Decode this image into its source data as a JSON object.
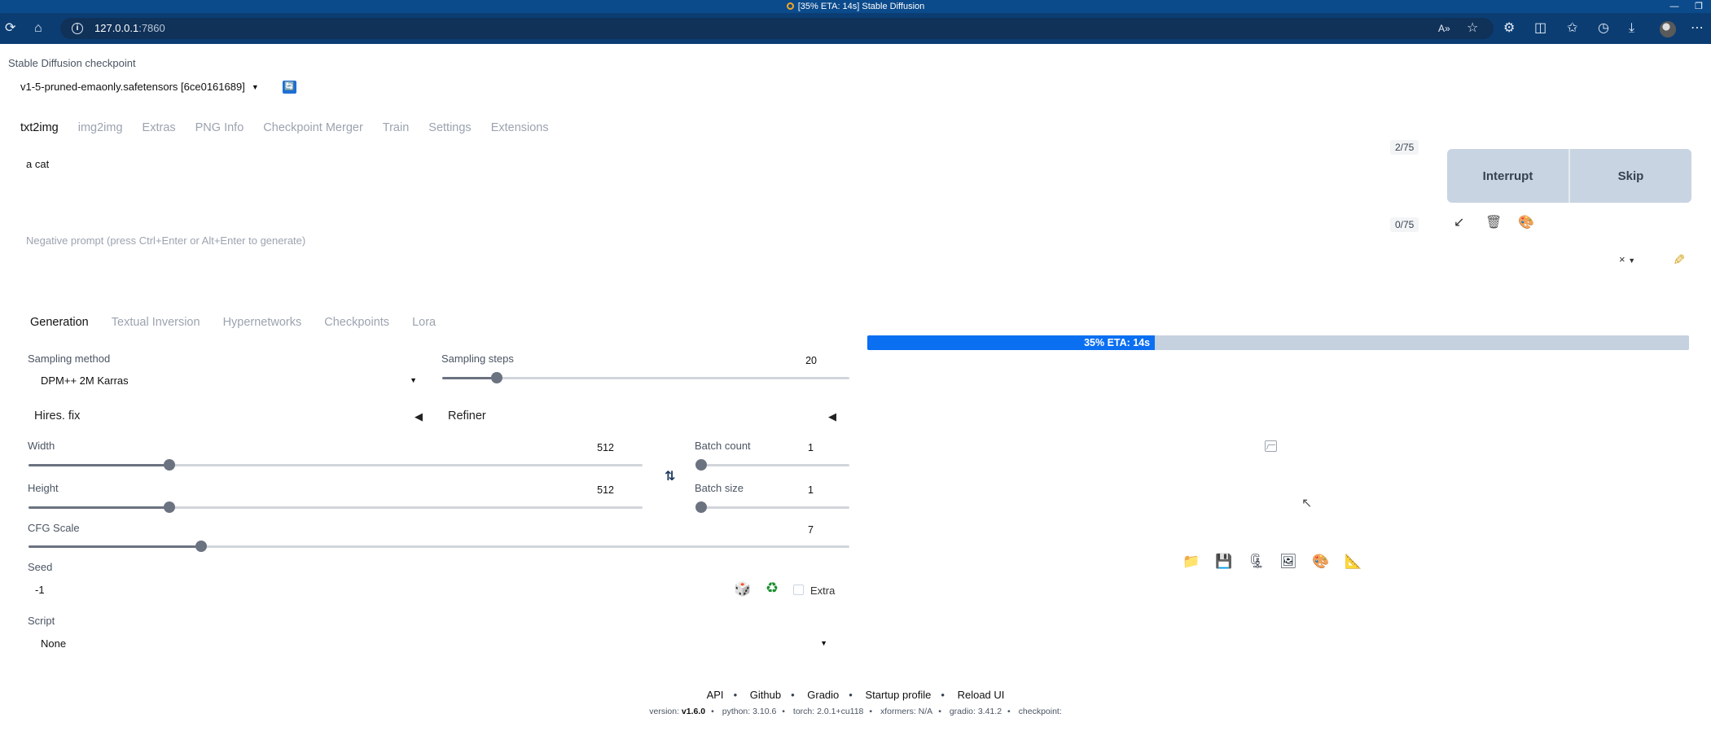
{
  "window": {
    "title": "[35% ETA: 14s] Stable Diffusion",
    "controls": [
      "—",
      "❐"
    ]
  },
  "browser": {
    "url_host": "127.0.0.1",
    "url_port": ":7860"
  },
  "checkpoint": {
    "label": "Stable Diffusion checkpoint",
    "selected": "v1-5-pruned-emaonly.safetensors [6ce0161689]"
  },
  "tabs": [
    "txt2img",
    "img2img",
    "Extras",
    "PNG Info",
    "Checkpoint Merger",
    "Train",
    "Settings",
    "Extensions"
  ],
  "prompt": {
    "value": "a cat",
    "counter": "2/75"
  },
  "negative_prompt": {
    "placeholder": "Negative prompt (press Ctrl+Enter or Alt+Enter to generate)",
    "counter": "0/75"
  },
  "buttons": {
    "interrupt": "Interrupt",
    "skip": "Skip"
  },
  "styles": {
    "clear": "×"
  },
  "subtabs": [
    "Generation",
    "Textual Inversion",
    "Hypernetworks",
    "Checkpoints",
    "Lora"
  ],
  "sampling": {
    "method_label": "Sampling method",
    "method_value": "DPM++ 2M Karras",
    "steps_label": "Sampling steps",
    "steps_value": "20",
    "steps_fraction": 0.133
  },
  "accordions": {
    "hires": "Hires. fix",
    "refiner": "Refiner"
  },
  "width": {
    "label": "Width",
    "value": "512",
    "fraction": 0.23
  },
  "height": {
    "label": "Height",
    "value": "512",
    "fraction": 0.23
  },
  "batch_count": {
    "label": "Batch count",
    "value": "1",
    "fraction": 0.0
  },
  "batch_size": {
    "label": "Batch size",
    "value": "1",
    "fraction": 0.0
  },
  "cfg": {
    "label": "CFG Scale",
    "value": "7",
    "fraction": 0.21
  },
  "seed": {
    "label": "Seed",
    "value": "-1",
    "extra_label": "Extra"
  },
  "script": {
    "label": "Script",
    "value": "None"
  },
  "progress": {
    "text": "35% ETA: 14s",
    "fraction": 0.35
  },
  "footer": {
    "links": [
      "API",
      "Github",
      "Gradio",
      "Startup profile",
      "Reload UI"
    ],
    "version_label": "version:",
    "version_value": "v1.6.0",
    "python": "python: 3.10.6",
    "torch": "torch: 2.0.1+cu118",
    "xformers": "xformers: N/A",
    "gradio": "gradio: 3.41.2",
    "checkpoint": "checkpoint:"
  },
  "icons": {
    "refresh": "🔄",
    "paste": "↙",
    "trash": "🗑",
    "style": "🎨",
    "folder": "📁",
    "save": "💾",
    "zip": "🗜",
    "to_img2img": "🖼",
    "to_inpaint": "🎨",
    "to_extras": "📐",
    "dice": "🎲",
    "recycle": "♻"
  }
}
